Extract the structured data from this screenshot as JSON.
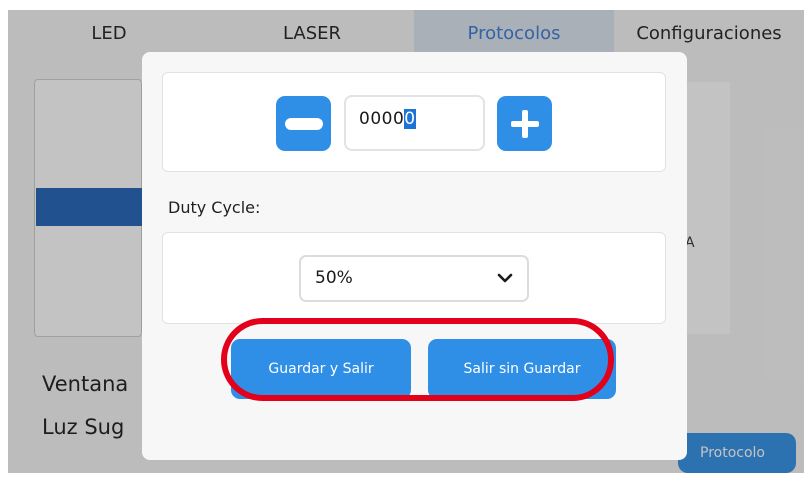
{
  "tabs": [
    {
      "label": "LED",
      "active": false
    },
    {
      "label": "LASER",
      "active": false
    },
    {
      "label": "Protocolos",
      "active": true
    },
    {
      "label": "Configuraciones",
      "active": false
    }
  ],
  "background": {
    "line1": "Ventana",
    "line2": "Luz Sug",
    "right_char": "A",
    "protocol_button": "Protocolo"
  },
  "modal": {
    "stepper": {
      "value_prefix": "0000",
      "value_selected": "0",
      "minus_icon": "minus-icon",
      "plus_icon": "plus-icon"
    },
    "duty_cycle_label": "Duty Cycle:",
    "duty_cycle_value": "50%",
    "save_button": "Guardar y Salir",
    "exit_button": "Salir sin Guardar"
  },
  "colors": {
    "accent": "#2f8fe6",
    "active_tab_text": "#3a7bd5",
    "highlight": "#e2001a"
  }
}
